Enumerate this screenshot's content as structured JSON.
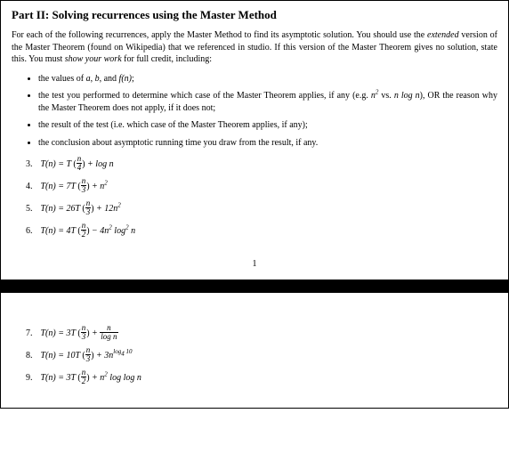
{
  "title": "Part II: Solving recurrences using the Master Method",
  "intro_parts": {
    "p1": "For each of the following recurrences, apply the Master Method to find its asymptotic solution. You should use the ",
    "p2_italic": "extended",
    "p3": " version of the Master Theorem (found on Wikipedia) that we referenced in studio. If this version of the Master Theorem gives no solution, state this. You must ",
    "p4_italic": "show your work",
    "p5": " for full credit, including:"
  },
  "bullets": {
    "b1_a": "the values of ",
    "b1_b": ", and ",
    "b1_c": ";",
    "b2_a": "the test you performed to determine which case of the Master Theorem applies, if any (e.g. ",
    "b2_b": " vs. ",
    "b2_c": "), OR the reason why the Master Theorem does not apply, if it does not;",
    "b3": "the result of the test (i.e. which case of the Master Theorem applies, if any);",
    "b4": "the conclusion about asymptotic running time you draw from the result, if any."
  },
  "problems_page1": [
    {
      "num": "3.",
      "lhs": "T(n) = T",
      "div": "4",
      "tail": " + log n"
    },
    {
      "num": "4.",
      "lhs": "T(n) = 7T",
      "div": "3",
      "tail": " + n",
      "sup": "2"
    },
    {
      "num": "5.",
      "lhs": "T(n) = 26T",
      "div": "3",
      "tail": " + 12n",
      "sup": "2"
    },
    {
      "num": "6.",
      "lhs": "T(n) = 4T",
      "div": "2",
      "tail": " − 4n",
      "sup": "2",
      "tail2": " log",
      "sup2": "2",
      "tail3": " n"
    }
  ],
  "page_number": "1",
  "problems_page2": [
    {
      "num": "7.",
      "lhs": "T(n) = 3T",
      "div": "3",
      "tail_frac_num": "n",
      "tail_frac_den": "log n"
    },
    {
      "num": "8.",
      "lhs": "T(n) = 10T",
      "div": "3",
      "tail": " + 3n",
      "supexp": "log",
      "supsub": "4",
      "supexp2": " 10"
    },
    {
      "num": "9.",
      "lhs": "T(n) = 3T",
      "div": "2",
      "tail": " + n",
      "sup": "2",
      "tail2": " log log n"
    }
  ],
  "math_tokens": {
    "a": "a",
    "b": "b",
    "fn": "f(n)",
    "n2": "n",
    "nlogn": "n log n",
    "frac_n": "n"
  }
}
